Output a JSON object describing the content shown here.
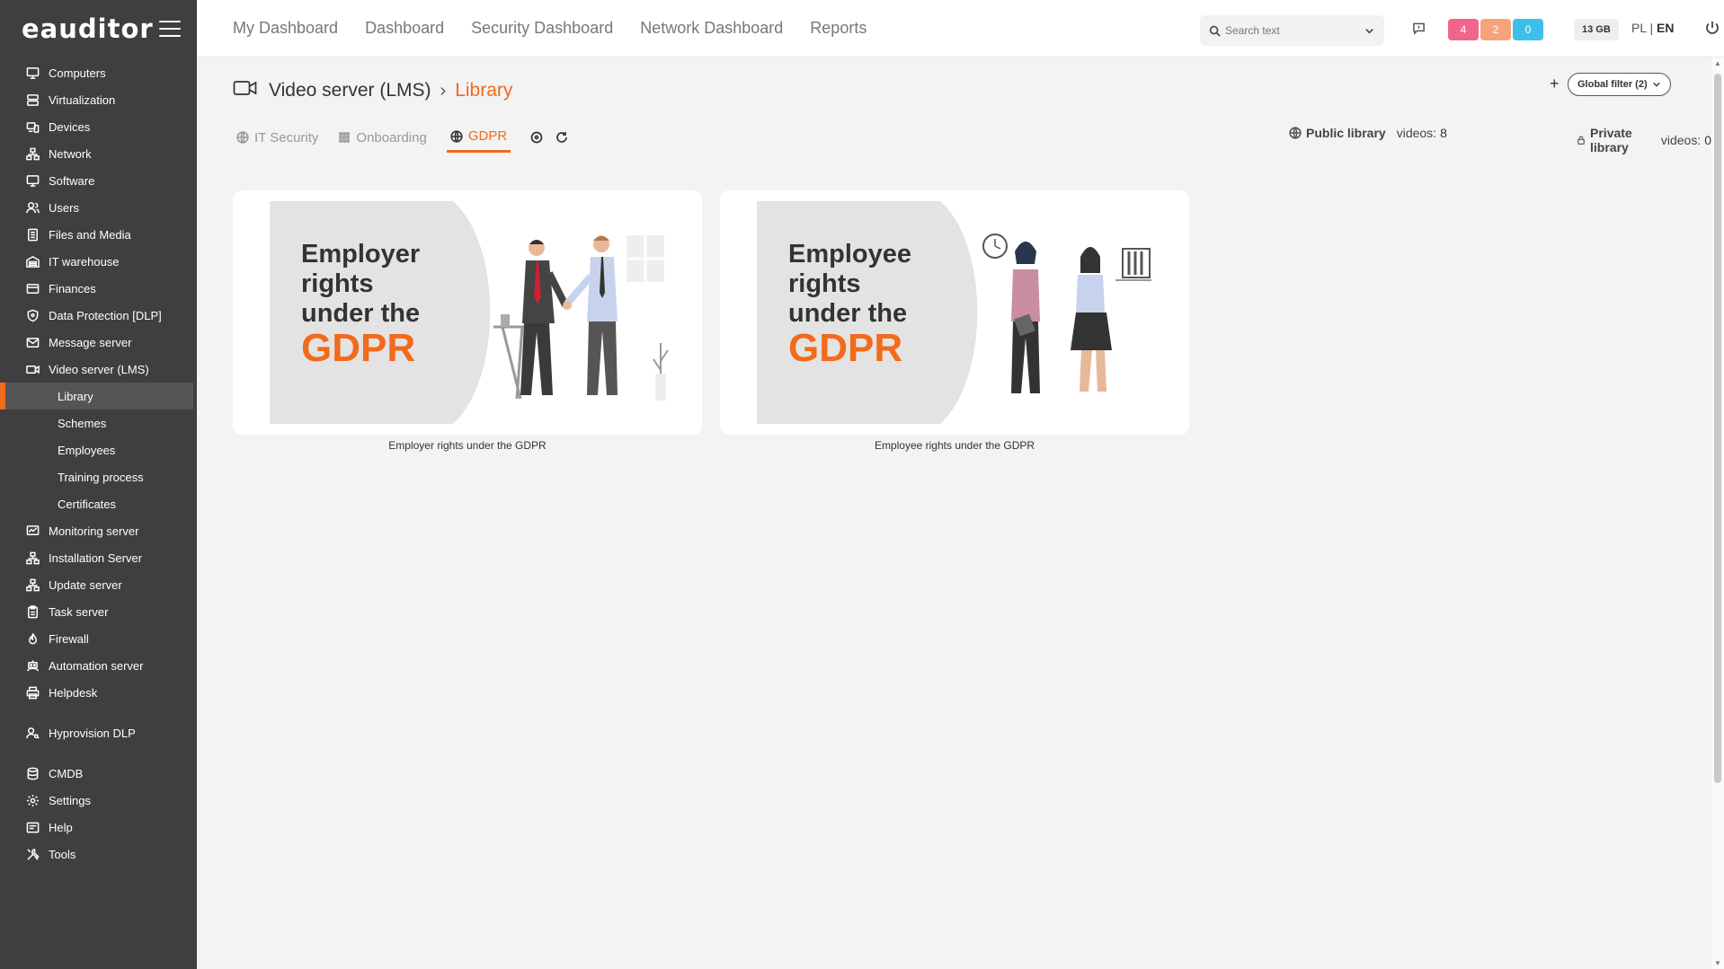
{
  "app": {
    "logo": "eauditor",
    "title": "Video server (LMS) - Library"
  },
  "sidebar": {
    "items": [
      {
        "label": "Computers",
        "icon": "monitor-icon"
      },
      {
        "label": "Virtualization",
        "icon": "server-icon"
      },
      {
        "label": "Devices",
        "icon": "devices-icon"
      },
      {
        "label": "Network",
        "icon": "network-icon"
      },
      {
        "label": "Software",
        "icon": "monitor-icon"
      },
      {
        "label": "Users",
        "icon": "users-icon"
      },
      {
        "label": "Files and Media",
        "icon": "file-icon"
      },
      {
        "label": "IT warehouse",
        "icon": "warehouse-icon"
      },
      {
        "label": "Finances",
        "icon": "card-icon"
      },
      {
        "label": "Data Protection [DLP]",
        "icon": "shield-icon"
      },
      {
        "label": "Message server",
        "icon": "mail-icon"
      },
      {
        "label": "Video server (LMS)",
        "icon": "video-icon"
      }
    ],
    "sub_items": [
      {
        "label": "Library"
      },
      {
        "label": "Schemes"
      },
      {
        "label": "Employees"
      },
      {
        "label": "Training process"
      },
      {
        "label": "Certificates"
      }
    ],
    "items2": [
      {
        "label": "Monitoring server",
        "icon": "monitoring-icon"
      },
      {
        "label": "Installation Server",
        "icon": "network-icon"
      },
      {
        "label": "Update server",
        "icon": "network-icon"
      },
      {
        "label": "Task server",
        "icon": "clipboard-icon"
      },
      {
        "label": "Firewall",
        "icon": "fire-icon"
      },
      {
        "label": "Automation server",
        "icon": "robot-icon"
      },
      {
        "label": "Helpdesk",
        "icon": "printer-icon"
      }
    ],
    "items3": [
      {
        "label": "Hyprovision DLP",
        "icon": "user-key-icon"
      }
    ],
    "items4": [
      {
        "label": "CMDB",
        "icon": "database-icon"
      },
      {
        "label": "Settings",
        "icon": "gear-icon"
      },
      {
        "label": "Help",
        "icon": "help-icon"
      },
      {
        "label": "Tools",
        "icon": "tools-icon"
      }
    ]
  },
  "topnav": {
    "links": [
      "My Dashboard",
      "Dashboard",
      "Security Dashboard",
      "Network Dashboard",
      "Reports"
    ],
    "search_placeholder": "Search text",
    "badges": [
      {
        "value": "4",
        "color": "#f0668a"
      },
      {
        "value": "2",
        "color": "#f6a37a"
      },
      {
        "value": "0",
        "color": "#3cbfe8"
      }
    ],
    "storage": "13 GB",
    "lang_pl": "PL",
    "lang_sep": "|",
    "lang_en": "EN"
  },
  "breadcrumb": {
    "section": "Video server (LMS)",
    "separator": "›",
    "current": "Library"
  },
  "global_filter": "Global filter (2)",
  "tabs": [
    {
      "label": "IT Security",
      "icon": "globe-icon",
      "active": false
    },
    {
      "label": "Onboarding",
      "icon": "grid-icon",
      "active": false
    },
    {
      "label": "GDPR",
      "icon": "globe-icon",
      "active": true
    }
  ],
  "public_library": {
    "label": "Public library",
    "videos_label": "videos:",
    "count": "8"
  },
  "private_library": {
    "label": "Private library",
    "videos_label": "videos:",
    "count": "0"
  },
  "videos": [
    {
      "line1": "Employer",
      "line2": "rights",
      "line3": "under the",
      "line4": "GDPR",
      "caption": "Employer rights under the GDPR"
    },
    {
      "line1": "Employee",
      "line2": "rights",
      "line3": "under the",
      "line4": "GDPR",
      "caption": "Employee rights under the GDPR"
    }
  ],
  "colors": {
    "accent": "#f26a1b",
    "sidebar": "#3f3f3f"
  }
}
